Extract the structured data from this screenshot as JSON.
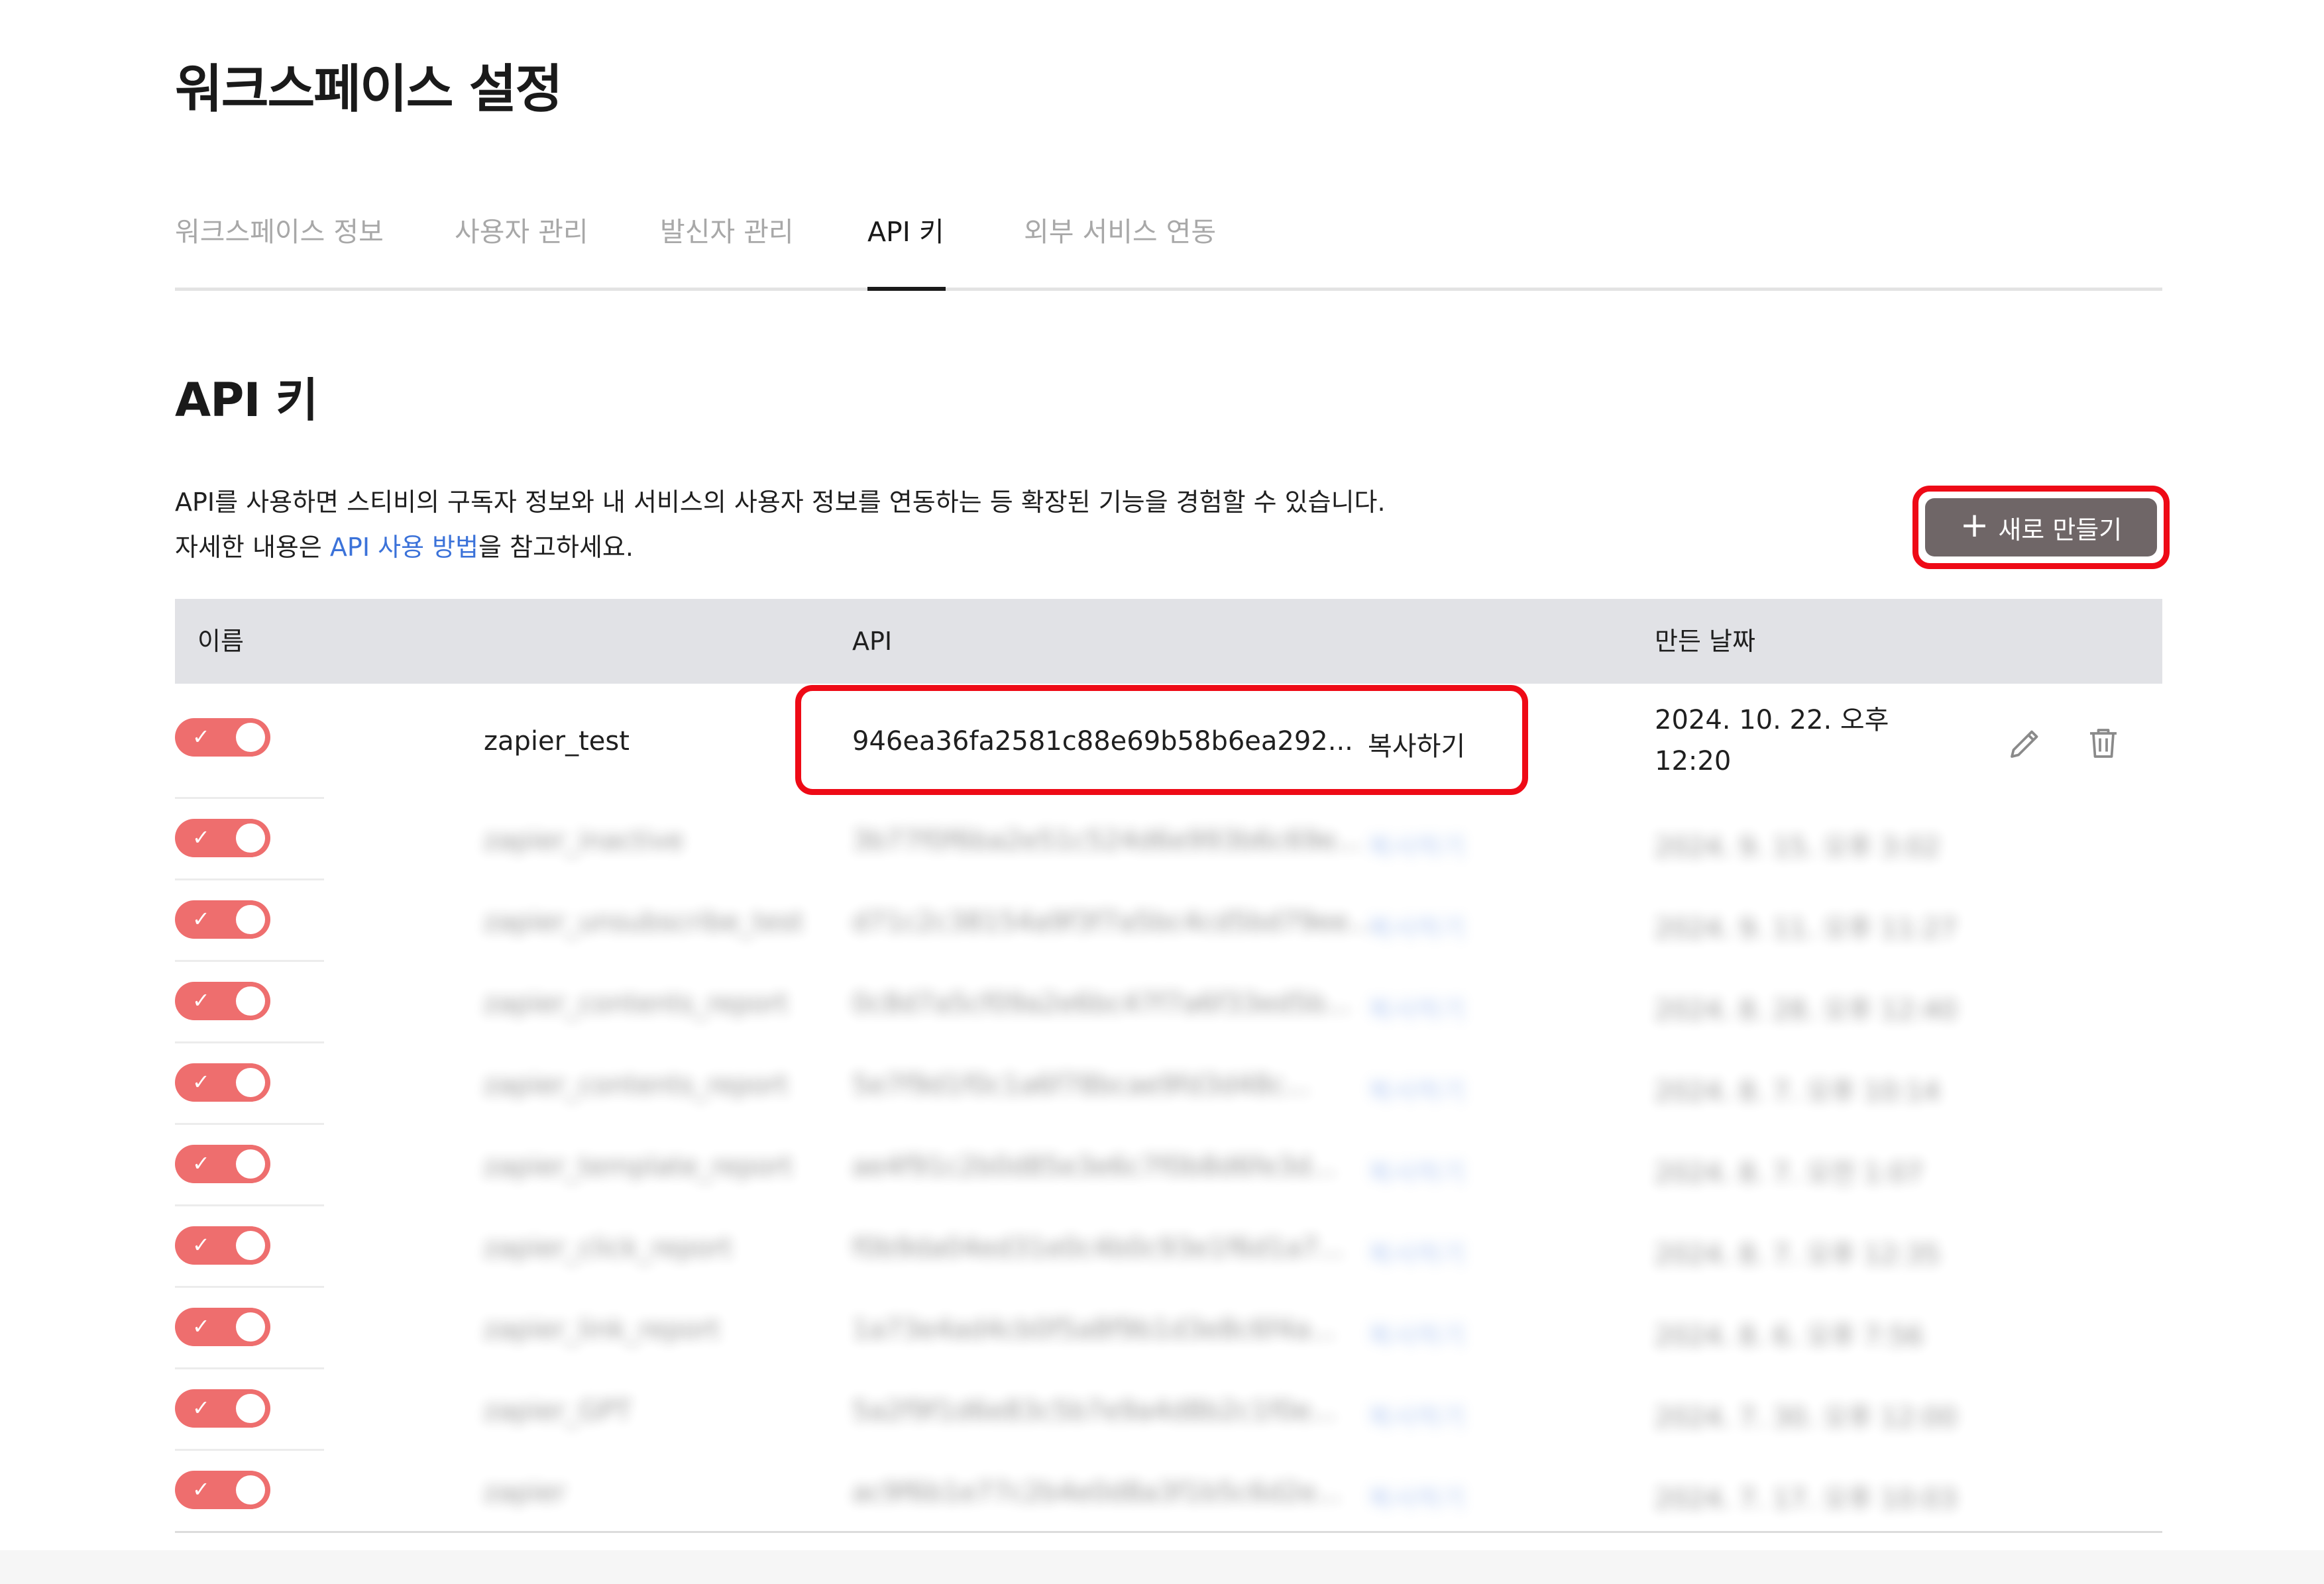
{
  "page": {
    "title": "워크스페이스 설정"
  },
  "tabs": [
    {
      "label": "워크스페이스 정보",
      "active": false
    },
    {
      "label": "사용자 관리",
      "active": false
    },
    {
      "label": "발신자 관리",
      "active": false
    },
    {
      "label": "API 키",
      "active": true
    },
    {
      "label": "외부 서비스 연동",
      "active": false
    }
  ],
  "section": {
    "title": "API 키",
    "desc_line1": "API를 사용하면 스티비의 구독자 정보와 내 서비스의 사용자 정보를 연동하는 등 확장된 기능을 경험할 수 있습니다.",
    "desc_line2_prefix": "자세한 내용은 ",
    "desc_line2_link": "API 사용 방법",
    "desc_line2_suffix": "을 참고하세요.",
    "new_button": "새로 만들기"
  },
  "table": {
    "headers": {
      "name": "이름",
      "api": "API",
      "created": "만든 날짜"
    },
    "copy_label": "복사하기",
    "rows": [
      {
        "enabled": true,
        "name": "zapier_test",
        "api": "946ea36fa2581c88e69b58b6ea292...",
        "created_line1": "2024. 10. 22. 오후",
        "created_line2": "12:20"
      },
      {
        "enabled": true,
        "name": "zapier_inactive",
        "api": "3b77f0f6ba2e51c524d6e993b6c69e...",
        "created": "2024. 9. 15. 오후 3:02"
      },
      {
        "enabled": true,
        "name": "zapier_unsubscribe_test",
        "api": "d71c2c38154a9f3f7a5bc4cd5bd79ee...",
        "created": "2024. 9. 11. 오후 11:27"
      },
      {
        "enabled": true,
        "name": "zapier_contents_report",
        "api": "0c8d7a5cf09a2e6bc47f7a6f33ed5b...",
        "created": "2024. 8. 28. 오후 12:40"
      },
      {
        "enabled": true,
        "name": "zapier_contents_report",
        "api": "5e7f9d1f0c1a6f78bcae9fd3d48c...",
        "created": "2024. 8. 7. 오후 10:14"
      },
      {
        "enabled": true,
        "name": "zapier_template_report",
        "api": "ae4f91c2b0d85e3e6c7f0b8d6fe3d...",
        "created": "2024. 8. 7. 오전 1:07"
      },
      {
        "enabled": true,
        "name": "zapier_click_report",
        "api": "f0b9da04ed31e0c4b0c93e1f6d1a7...",
        "created": "2024. 8. 7. 오후 12:35"
      },
      {
        "enabled": true,
        "name": "zapier_link_report",
        "api": "1a73e4ad4cb0f5a8f9b1d3e8c6f4a...",
        "created": "2024. 8. 6. 오후 7:56"
      },
      {
        "enabled": true,
        "name": "zapier_GPT",
        "api": "5a2f9f1d6e83c5b7e9a4d8b2c1f0e...",
        "created": "2024. 7. 30. 오후 12:00"
      },
      {
        "enabled": true,
        "name": "zapier",
        "api": "ac9f6b1e77c2b4e0d8a3f1b5c6d2e...",
        "created": "2024. 7. 17. 오후 10:03"
      }
    ]
  },
  "icons": {
    "edit": "pencil-icon",
    "delete": "trash-icon",
    "toggle_check": "check-icon"
  },
  "colors": {
    "toggle_on": "#ee6e6e",
    "link": "#3b72d9",
    "button": "#6f6667",
    "highlight": "#ee0a16"
  }
}
